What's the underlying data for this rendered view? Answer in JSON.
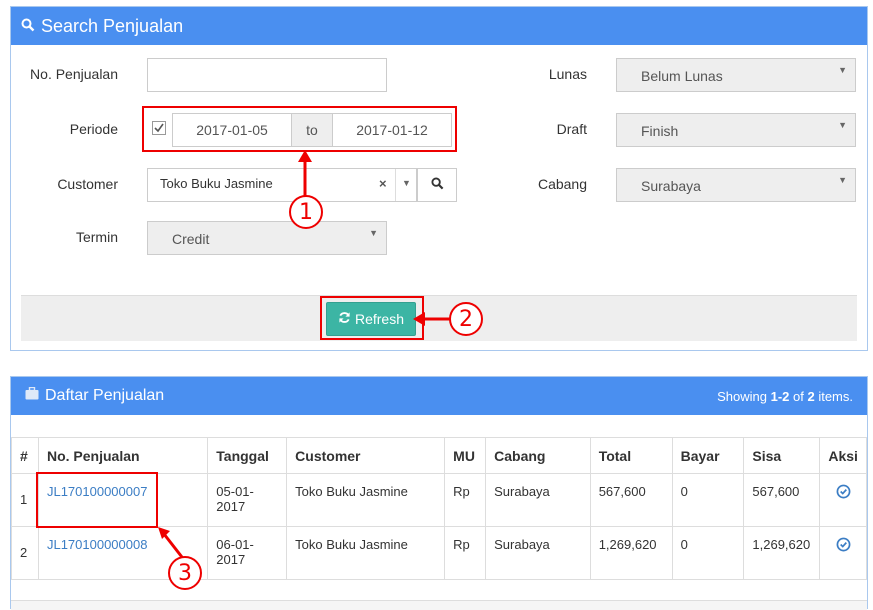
{
  "search": {
    "title": "Search Penjualan",
    "no_penjualan_label": "No. Penjualan",
    "no_penjualan_value": "",
    "periode_label": "Periode",
    "date_from": "2017-01-05",
    "date_sep": "to",
    "date_to": "2017-01-12",
    "customer_label": "Customer",
    "customer_value": "Toko Buku Jasmine",
    "termin_label": "Termin",
    "termin_value": "Credit",
    "lunas_label": "Lunas",
    "lunas_value": "Belum Lunas",
    "draft_label": "Draft",
    "draft_value": "Finish",
    "cabang_label": "Cabang",
    "cabang_value": "Surabaya",
    "refresh_label": "Refresh"
  },
  "callouts": [
    "1",
    "2",
    "3"
  ],
  "list": {
    "title": "Daftar Penjualan",
    "summary_prefix": "Showing ",
    "summary_range": "1-2",
    "summary_mid": " of ",
    "summary_total": "2",
    "summary_suffix": " items.",
    "columns": [
      "#",
      "No. Penjualan",
      "Tanggal",
      "Customer",
      "MU",
      "Cabang",
      "Total",
      "Bayar",
      "Sisa",
      "Aksi"
    ],
    "rows": [
      {
        "no": "1",
        "id": "JL170100000007",
        "date1": "05-01-",
        "date2": "2017",
        "customer": "Toko Buku Jasmine",
        "mu": "Rp",
        "cabang": "Surabaya",
        "total": "567,600",
        "bayar": "0",
        "sisa": "567,600"
      },
      {
        "no": "2",
        "id": "JL170100000008",
        "date1": "06-01-",
        "date2": "2017",
        "customer": "Toko Buku Jasmine",
        "mu": "Rp",
        "cabang": "Surabaya",
        "total": "1,269,620",
        "bayar": "0",
        "sisa": "1,269,620"
      }
    ]
  },
  "icons": {
    "search_header": "search-icon",
    "refresh": "refresh-icon",
    "briefcase": "briefcase-icon",
    "aksi": "check-circle-icon"
  },
  "colors": {
    "header_blue": "#4a8ff0",
    "refresh_button": "#3cb5a4",
    "annotation_red": "#ee0000",
    "link_blue": "#3b7dc4"
  }
}
